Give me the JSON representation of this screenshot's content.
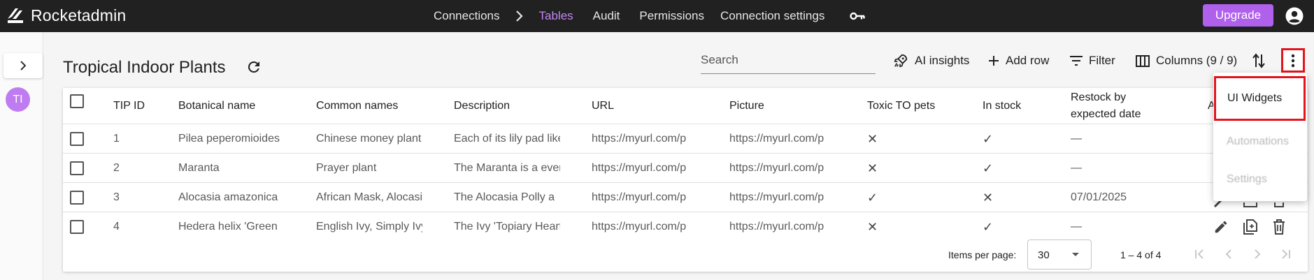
{
  "brand": {
    "name": "Rocketadmin"
  },
  "nav": {
    "items": [
      {
        "label": "Connections"
      },
      {
        "label": "Tables"
      },
      {
        "label": "Audit"
      },
      {
        "label": "Permissions"
      },
      {
        "label": "Connection settings"
      }
    ],
    "upgrade_label": "Upgrade"
  },
  "sidebar": {
    "avatar_initials": "TI"
  },
  "page": {
    "title": "Tropical Indoor Plants"
  },
  "toolbar": {
    "search_placeholder": "Search",
    "ai_insights": "AI insights",
    "add_row": "Add row",
    "filter": "Filter",
    "columns": "Columns (9 / 9)"
  },
  "table": {
    "headers": [
      "TIP ID",
      "Botanical name",
      "Common names",
      "Description",
      "URL",
      "Picture",
      "Toxic TO pets",
      "In stock",
      "Restock by",
      "expected date",
      "A"
    ],
    "rows": [
      {
        "id": "1",
        "botanical": "Pilea peperomioides",
        "common": "Chinese money plant",
        "description": "Each of its lily pad like",
        "url": "https://myurl.com/p",
        "picture": "https://myurl.com/p",
        "toxic": "✕",
        "in_stock": "✓",
        "restock": "—"
      },
      {
        "id": "2",
        "botanical": "Maranta",
        "common": "Prayer plant",
        "description": "The Maranta is a evergreen",
        "url": "https://myurl.com/p",
        "picture": "https://myurl.com/p",
        "toxic": "✕",
        "in_stock": "✓",
        "restock": "—"
      },
      {
        "id": "3",
        "botanical": "Alocasia amazonica",
        "common": "African Mask, Alocasia",
        "description": "The Alocasia Polly a",
        "url": "https://myurl.com/p",
        "picture": "https://myurl.com/p",
        "toxic": "✓",
        "in_stock": "✕",
        "restock": "07/01/2025"
      },
      {
        "id": "4",
        "botanical": "Hedera helix 'Green",
        "common": "English Ivy, Simply Ivy",
        "description": "The Ivy 'Topiary Heart'",
        "url": "https://myurl.com/p",
        "picture": "https://myurl.com/p",
        "toxic": "✕",
        "in_stock": "✓",
        "restock": "—"
      }
    ]
  },
  "pagination": {
    "items_per_page_label": "Items per page:",
    "items_per_page": "30",
    "range": "1 – 4 of 4"
  },
  "menu": {
    "items": [
      {
        "label": "UI Widgets"
      },
      {
        "label": "Automations"
      },
      {
        "label": "Settings"
      }
    ]
  },
  "colors": {
    "navbar_bg": "#212121",
    "accent": "#b061ec",
    "active_nav": "#c587f4",
    "highlight": "#e5141c"
  }
}
